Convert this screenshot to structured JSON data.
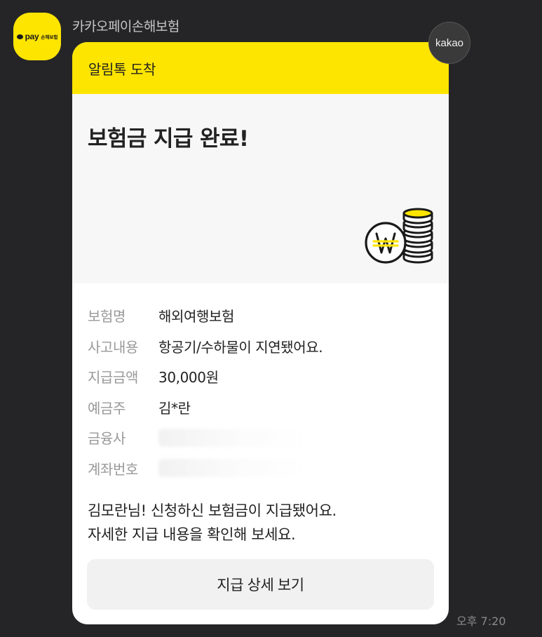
{
  "sender": {
    "name": "카카오페이손해보험",
    "avatar_pay": "pay",
    "avatar_brand": "손해보험"
  },
  "badge": {
    "label": "kakao"
  },
  "card": {
    "header": "알림톡 도착",
    "title": "보험금 지급 완료!",
    "details": [
      {
        "label": "보험명",
        "value": "해외여행보험"
      },
      {
        "label": "사고내용",
        "value": "항공기/수하물이 지연됐어요."
      },
      {
        "label": "지급금액",
        "value": "30,000원"
      },
      {
        "label": "예금주",
        "value": "김*란"
      },
      {
        "label": "금융사",
        "value": ""
      },
      {
        "label": "계좌번호",
        "value": ""
      }
    ],
    "message_line1": "김모란님! 신청하신 보험금이 지급됐어요.",
    "message_line2": "자세한 지급 내용을 확인해 보세요.",
    "button_label": "지급 상세 보기"
  },
  "timestamp": "오후 7:20",
  "colors": {
    "background": "#252527",
    "kakao_yellow": "#FEE500",
    "card": "#ffffff",
    "hero": "#f7f7f7",
    "button": "#f1f1f1"
  },
  "icons": {
    "illustration": "won-coin-stack-icon"
  }
}
